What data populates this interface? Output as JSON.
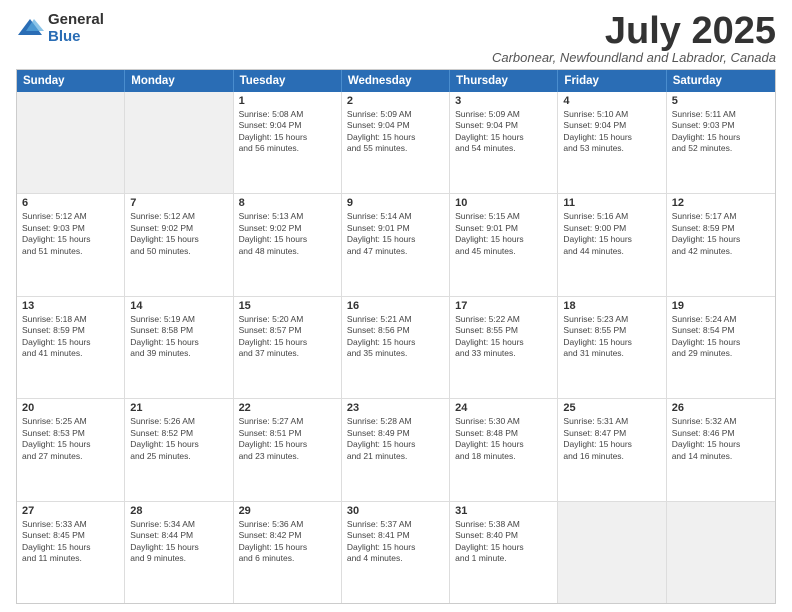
{
  "logo": {
    "general": "General",
    "blue": "Blue"
  },
  "title": {
    "month_year": "July 2025",
    "location": "Carbonear, Newfoundland and Labrador, Canada"
  },
  "header_days": [
    "Sunday",
    "Monday",
    "Tuesday",
    "Wednesday",
    "Thursday",
    "Friday",
    "Saturday"
  ],
  "weeks": [
    [
      {
        "day": "",
        "empty": true,
        "info": ""
      },
      {
        "day": "",
        "empty": true,
        "info": ""
      },
      {
        "day": "1",
        "info": "Sunrise: 5:08 AM\nSunset: 9:04 PM\nDaylight: 15 hours\nand 56 minutes."
      },
      {
        "day": "2",
        "info": "Sunrise: 5:09 AM\nSunset: 9:04 PM\nDaylight: 15 hours\nand 55 minutes."
      },
      {
        "day": "3",
        "info": "Sunrise: 5:09 AM\nSunset: 9:04 PM\nDaylight: 15 hours\nand 54 minutes."
      },
      {
        "day": "4",
        "info": "Sunrise: 5:10 AM\nSunset: 9:04 PM\nDaylight: 15 hours\nand 53 minutes."
      },
      {
        "day": "5",
        "info": "Sunrise: 5:11 AM\nSunset: 9:03 PM\nDaylight: 15 hours\nand 52 minutes."
      }
    ],
    [
      {
        "day": "6",
        "info": "Sunrise: 5:12 AM\nSunset: 9:03 PM\nDaylight: 15 hours\nand 51 minutes."
      },
      {
        "day": "7",
        "info": "Sunrise: 5:12 AM\nSunset: 9:02 PM\nDaylight: 15 hours\nand 50 minutes."
      },
      {
        "day": "8",
        "info": "Sunrise: 5:13 AM\nSunset: 9:02 PM\nDaylight: 15 hours\nand 48 minutes."
      },
      {
        "day": "9",
        "info": "Sunrise: 5:14 AM\nSunset: 9:01 PM\nDaylight: 15 hours\nand 47 minutes."
      },
      {
        "day": "10",
        "info": "Sunrise: 5:15 AM\nSunset: 9:01 PM\nDaylight: 15 hours\nand 45 minutes."
      },
      {
        "day": "11",
        "info": "Sunrise: 5:16 AM\nSunset: 9:00 PM\nDaylight: 15 hours\nand 44 minutes."
      },
      {
        "day": "12",
        "info": "Sunrise: 5:17 AM\nSunset: 8:59 PM\nDaylight: 15 hours\nand 42 minutes."
      }
    ],
    [
      {
        "day": "13",
        "info": "Sunrise: 5:18 AM\nSunset: 8:59 PM\nDaylight: 15 hours\nand 41 minutes."
      },
      {
        "day": "14",
        "info": "Sunrise: 5:19 AM\nSunset: 8:58 PM\nDaylight: 15 hours\nand 39 minutes."
      },
      {
        "day": "15",
        "info": "Sunrise: 5:20 AM\nSunset: 8:57 PM\nDaylight: 15 hours\nand 37 minutes."
      },
      {
        "day": "16",
        "info": "Sunrise: 5:21 AM\nSunset: 8:56 PM\nDaylight: 15 hours\nand 35 minutes."
      },
      {
        "day": "17",
        "info": "Sunrise: 5:22 AM\nSunset: 8:55 PM\nDaylight: 15 hours\nand 33 minutes."
      },
      {
        "day": "18",
        "info": "Sunrise: 5:23 AM\nSunset: 8:55 PM\nDaylight: 15 hours\nand 31 minutes."
      },
      {
        "day": "19",
        "info": "Sunrise: 5:24 AM\nSunset: 8:54 PM\nDaylight: 15 hours\nand 29 minutes."
      }
    ],
    [
      {
        "day": "20",
        "info": "Sunrise: 5:25 AM\nSunset: 8:53 PM\nDaylight: 15 hours\nand 27 minutes."
      },
      {
        "day": "21",
        "info": "Sunrise: 5:26 AM\nSunset: 8:52 PM\nDaylight: 15 hours\nand 25 minutes."
      },
      {
        "day": "22",
        "info": "Sunrise: 5:27 AM\nSunset: 8:51 PM\nDaylight: 15 hours\nand 23 minutes."
      },
      {
        "day": "23",
        "info": "Sunrise: 5:28 AM\nSunset: 8:49 PM\nDaylight: 15 hours\nand 21 minutes."
      },
      {
        "day": "24",
        "info": "Sunrise: 5:30 AM\nSunset: 8:48 PM\nDaylight: 15 hours\nand 18 minutes."
      },
      {
        "day": "25",
        "info": "Sunrise: 5:31 AM\nSunset: 8:47 PM\nDaylight: 15 hours\nand 16 minutes."
      },
      {
        "day": "26",
        "info": "Sunrise: 5:32 AM\nSunset: 8:46 PM\nDaylight: 15 hours\nand 14 minutes."
      }
    ],
    [
      {
        "day": "27",
        "info": "Sunrise: 5:33 AM\nSunset: 8:45 PM\nDaylight: 15 hours\nand 11 minutes."
      },
      {
        "day": "28",
        "info": "Sunrise: 5:34 AM\nSunset: 8:44 PM\nDaylight: 15 hours\nand 9 minutes."
      },
      {
        "day": "29",
        "info": "Sunrise: 5:36 AM\nSunset: 8:42 PM\nDaylight: 15 hours\nand 6 minutes."
      },
      {
        "day": "30",
        "info": "Sunrise: 5:37 AM\nSunset: 8:41 PM\nDaylight: 15 hours\nand 4 minutes."
      },
      {
        "day": "31",
        "info": "Sunrise: 5:38 AM\nSunset: 8:40 PM\nDaylight: 15 hours\nand 1 minute."
      },
      {
        "day": "",
        "empty": true,
        "info": ""
      },
      {
        "day": "",
        "empty": true,
        "info": ""
      }
    ]
  ]
}
